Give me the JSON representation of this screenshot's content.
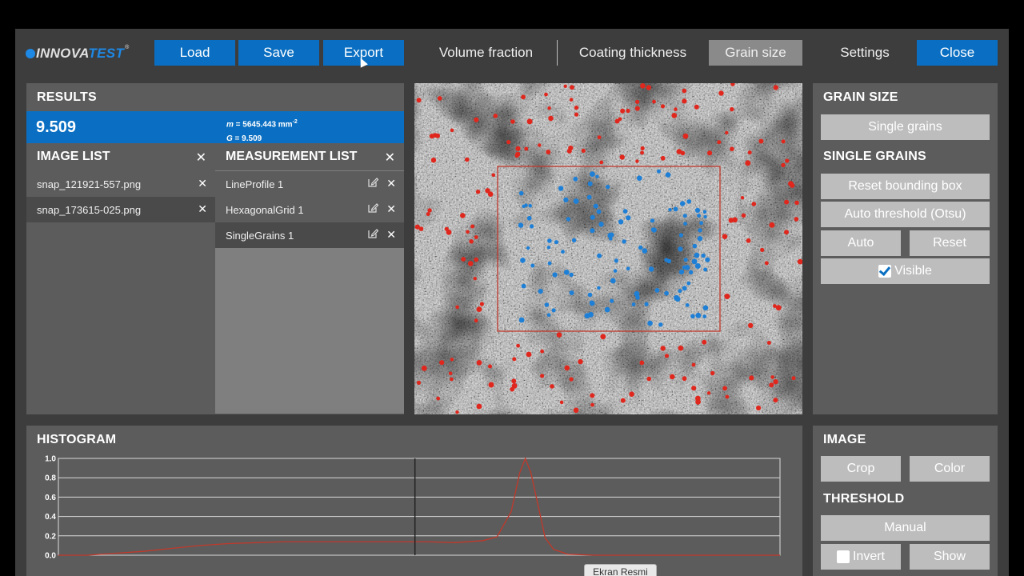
{
  "logo": {
    "part1": "INNOVA",
    "part2": "TEST",
    "reg": "®"
  },
  "toolbar": {
    "load": "Load",
    "save": "Save",
    "export": "Export",
    "volume_fraction": "Volume fraction",
    "coating_thickness": "Coating thickness",
    "grain_size": "Grain size",
    "settings": "Settings",
    "close": "Close"
  },
  "results": {
    "title": "RESULTS",
    "value": "9.509",
    "m_label": "m",
    "m_value": " = 5645.443 mm",
    "m_exp": "-2",
    "g_label": "G",
    "g_value": " = 9.509"
  },
  "image_list": {
    "title": "IMAGE LIST",
    "items": [
      "snap_121921-557.png",
      "snap_173615-025.png"
    ],
    "selected_index": 1
  },
  "measurement_list": {
    "title": "MEASUREMENT LIST",
    "items": [
      "LineProfile 1",
      "HexagonalGrid 1",
      "SingleGrains 1"
    ],
    "selected_index": 2
  },
  "close_glyph": "✕",
  "grain_panel": {
    "title": "GRAIN SIZE",
    "single_grains_button": "Single grains",
    "section_title": "SINGLE GRAINS",
    "reset_bbox": "Reset bounding box",
    "auto_threshold": "Auto threshold (Otsu)",
    "auto": "Auto",
    "reset": "Reset",
    "visible": "Visible",
    "visible_checked": true
  },
  "histogram": {
    "title": "HISTOGRAM"
  },
  "image_panel": {
    "title": "IMAGE",
    "crop": "Crop",
    "color": "Color",
    "threshold_title": "THRESHOLD",
    "manual": "Manual",
    "invert": "Invert",
    "invert_checked": false,
    "show": "Show"
  },
  "tooltip": "Ekran Resmi",
  "colors": {
    "accent": "#0a6fc2",
    "panel": "#5c5c5c",
    "background": "#3d3d3d",
    "grain_outside": "#e0271d",
    "grain_inside": "#1e7fd6",
    "histogram_line": "#c0392b"
  },
  "chart_data": {
    "type": "line",
    "ytick_labels": [
      "1.0",
      "0.8",
      "0.6",
      "0.4",
      "0.2",
      "0.0"
    ],
    "ylim": [
      0,
      1
    ],
    "xlim": [
      0,
      255
    ],
    "threshold": 126,
    "series": [
      {
        "x": [
          0,
          10,
          20,
          30,
          40,
          50,
          60,
          70,
          80,
          90,
          100,
          110,
          120,
          130,
          140,
          150,
          155,
          160,
          163,
          165,
          167,
          170,
          172,
          175,
          180,
          190,
          200,
          220,
          240,
          255
        ],
        "values": [
          0.0,
          0.0,
          0.02,
          0.04,
          0.07,
          0.1,
          0.12,
          0.13,
          0.14,
          0.14,
          0.14,
          0.14,
          0.14,
          0.14,
          0.13,
          0.15,
          0.19,
          0.45,
          0.85,
          1.0,
          0.85,
          0.45,
          0.18,
          0.06,
          0.01,
          0.0,
          0.0,
          0.0,
          0.0,
          0.0
        ]
      }
    ]
  }
}
